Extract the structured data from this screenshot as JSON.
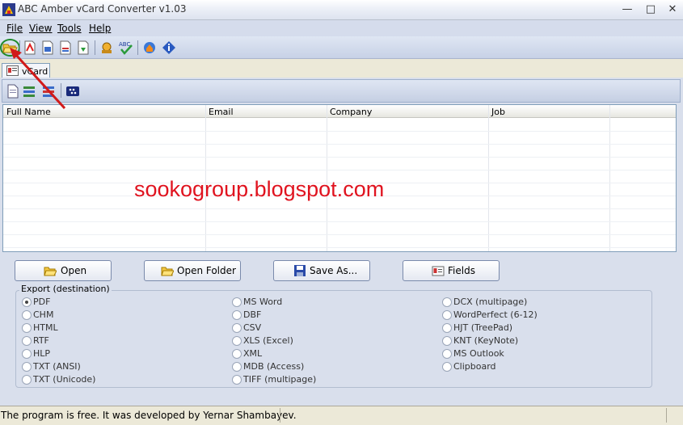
{
  "window": {
    "title": "ABC Amber vCard Converter v1.03"
  },
  "menu": {
    "file": "File",
    "view": "View",
    "tools": "Tools",
    "help": "Help"
  },
  "tabs": [
    {
      "label": "vCard"
    }
  ],
  "grid": {
    "columns": [
      "Full Name",
      "Email",
      "Company",
      "Job"
    ],
    "rows": []
  },
  "watermark": "sookogroup.blogspot.com",
  "actions": {
    "open": "Open",
    "open_folder": "Open Folder",
    "save_as": "Save As...",
    "fields": "Fields"
  },
  "export": {
    "legend": "Export (destination)",
    "selected": "PDF",
    "options": [
      "PDF",
      "CHM",
      "HTML",
      "RTF",
      "HLP",
      "TXT (ANSI)",
      "TXT (Unicode)",
      "MS Word",
      "DBF",
      "CSV",
      "XLS (Excel)",
      "XML",
      "MDB (Access)",
      "TIFF (multipage)",
      "DCX (multipage)",
      "WordPerfect (6-12)",
      "HJT (TreePad)",
      "KNT (KeyNote)",
      "MS Outlook",
      "Clipboard"
    ]
  },
  "status": {
    "text": "The program is free. It was developed by Yernar Shambayev."
  },
  "colors": {
    "watermark": "#e0131f",
    "annotation_arrow": "#d11a1a",
    "highlight_ring": "#1d8a2b"
  }
}
